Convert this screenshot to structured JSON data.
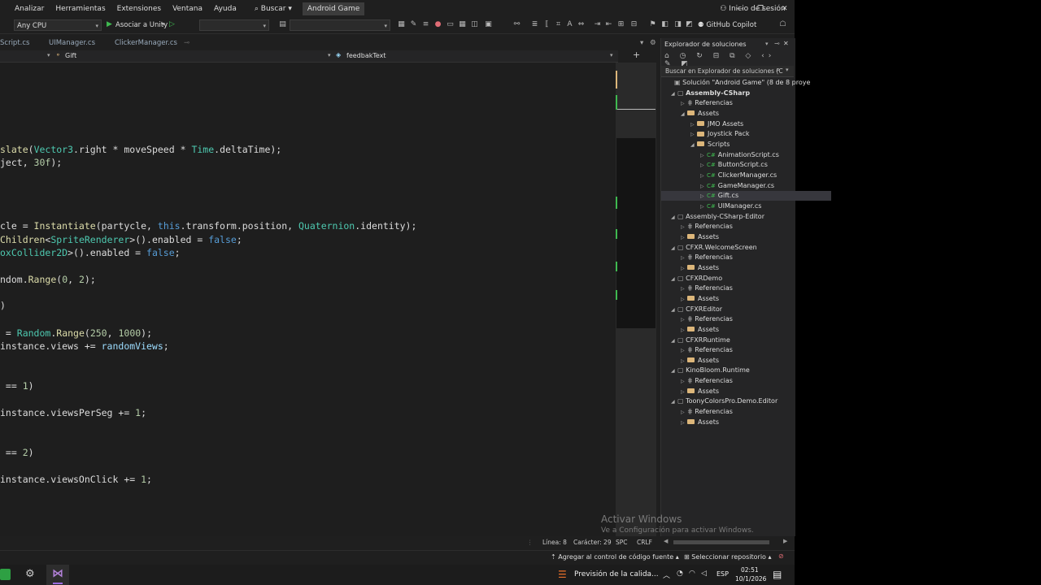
{
  "menubar": {
    "items": [
      "Analizar",
      "Herramientas",
      "Extensiones",
      "Ventana",
      "Ayuda"
    ],
    "search": "Buscar",
    "title": "Android Game",
    "signin": "Inicio de sesión"
  },
  "toolbar": {
    "platform": "Any CPU",
    "attach": "Asociar a Unity",
    "copilot": "GitHub Copilot"
  },
  "tabs": [
    "Script.cs",
    "UIManager.cs",
    "ClickerManager.cs"
  ],
  "navbar": {
    "left": "Gift",
    "right": "feedbakText"
  },
  "solution_explorer": {
    "title": "Explorador de soluciones",
    "search": "Buscar en Explorador de soluciones (C",
    "items": [
      {
        "label": "Solución \"Android Game\" (8 de 8 proye",
        "indent": 0,
        "kind": "solution"
      },
      {
        "label": "Assembly-CSharp",
        "indent": 1,
        "kind": "project"
      },
      {
        "label": "Referencias",
        "indent": 2,
        "kind": "ref"
      },
      {
        "label": "Assets",
        "indent": 2,
        "kind": "folder"
      },
      {
        "label": "JMO Assets",
        "indent": 3,
        "kind": "folder"
      },
      {
        "label": "Joystick Pack",
        "indent": 3,
        "kind": "folder"
      },
      {
        "label": "Scripts",
        "indent": 3,
        "kind": "folder"
      },
      {
        "label": "AnimationScript.cs",
        "indent": 4,
        "kind": "cs"
      },
      {
        "label": "ButtonScript.cs",
        "indent": 4,
        "kind": "cs"
      },
      {
        "label": "ClickerManager.cs",
        "indent": 4,
        "kind": "cs"
      },
      {
        "label": "GameManager.cs",
        "indent": 4,
        "kind": "cs"
      },
      {
        "label": "Gift.cs",
        "indent": 4,
        "kind": "cs"
      },
      {
        "label": "UIManager.cs",
        "indent": 4,
        "kind": "cs"
      },
      {
        "label": "Assembly-CSharp-Editor",
        "indent": 1,
        "kind": "project"
      },
      {
        "label": "Referencias",
        "indent": 2,
        "kind": "ref"
      },
      {
        "label": "Assets",
        "indent": 2,
        "kind": "folder"
      },
      {
        "label": "CFXR.WelcomeScreen",
        "indent": 1,
        "kind": "project"
      },
      {
        "label": "Referencias",
        "indent": 2,
        "kind": "ref"
      },
      {
        "label": "Assets",
        "indent": 2,
        "kind": "folder"
      },
      {
        "label": "CFXRDemo",
        "indent": 1,
        "kind": "project"
      },
      {
        "label": "Referencias",
        "indent": 2,
        "kind": "ref"
      },
      {
        "label": "Assets",
        "indent": 2,
        "kind": "folder"
      },
      {
        "label": "CFXREditor",
        "indent": 1,
        "kind": "project"
      },
      {
        "label": "Referencias",
        "indent": 2,
        "kind": "ref"
      },
      {
        "label": "Assets",
        "indent": 2,
        "kind": "folder"
      },
      {
        "label": "CFXRRuntime",
        "indent": 1,
        "kind": "project"
      },
      {
        "label": "Referencias",
        "indent": 2,
        "kind": "ref"
      },
      {
        "label": "Assets",
        "indent": 2,
        "kind": "folder"
      },
      {
        "label": "KinoBloom.Runtime",
        "indent": 1,
        "kind": "project"
      },
      {
        "label": "Referencias",
        "indent": 2,
        "kind": "ref"
      },
      {
        "label": "Assets",
        "indent": 2,
        "kind": "folder"
      },
      {
        "label": "ToonyColorsPro.Demo.Editor",
        "indent": 1,
        "kind": "project"
      },
      {
        "label": "Referencias",
        "indent": 2,
        "kind": "ref"
      },
      {
        "label": "Assets",
        "indent": 2,
        "kind": "folder"
      }
    ]
  },
  "status": {
    "line": "Línea: 8",
    "char": "Carácter: 29",
    "spc": "SPC",
    "crlf": "CRLF"
  },
  "bottom": {
    "source": "Agregar al control de código fuente",
    "repo": "Seleccionar repositorio"
  },
  "watermark": {
    "title": "Activar Windows",
    "sub": "Ve a Configuración para activar Windows."
  },
  "taskbar": {
    "weather": "Previsión de la calida...",
    "lang": "ESP",
    "time": "02:51",
    "date": "10/1/2026"
  }
}
